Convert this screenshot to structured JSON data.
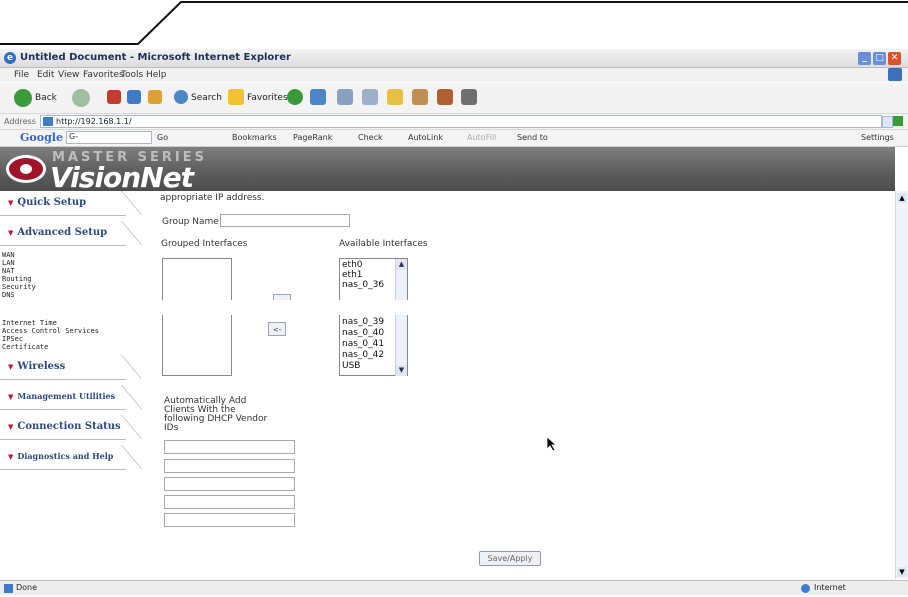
{
  "window": {
    "title": "Untitled Document - Microsoft Internet Explorer"
  },
  "menu": [
    "File",
    "Edit",
    "View",
    "Favorites",
    "Tools",
    "Help"
  ],
  "toolbar": {
    "back": "Back",
    "search": "Search",
    "favorites": "Favorites"
  },
  "address": {
    "label": "Address",
    "url": "http://192.168.1.1/",
    "go": "Go"
  },
  "google_bar": {
    "logo": "Google",
    "search_box": "G-",
    "go": "Go",
    "bookmarks": "Bookmarks",
    "pagerank": "PageRank",
    "check": "Check",
    "autolink": "AutoLink",
    "autofill": "AutoFill",
    "send_to": "Send to",
    "settings": "Settings"
  },
  "header": {
    "master_series": "MASTER SERIES",
    "brand": "VisionNet"
  },
  "sidebar": {
    "quick_setup": "Quick Setup",
    "advanced_setup": "Advanced Setup",
    "advanced_items_top": [
      "WAN",
      "LAN",
      "NAT",
      "Routing",
      "Security",
      "DNS"
    ],
    "advanced_items_bottom": [
      "Internet Time",
      "Access Control Services",
      "IPSec",
      "Certificate"
    ],
    "wireless": "Wireless",
    "management": "Management Utilities",
    "connection": "Connection Status",
    "diagnostics": "Diagnostics and Help"
  },
  "main": {
    "intro": "appropriate IP address.",
    "group_name_label": "Group Name:",
    "group_name_value": "",
    "grouped_label": "Grouped Interfaces",
    "available_label": "Available Interfaces",
    "available_top": [
      "eth0",
      "eth1",
      "nas_0_36"
    ],
    "available_bottom": [
      "nas_0_39",
      "nas_0_40",
      "nas_0_41",
      "nas_0_42",
      "USB"
    ],
    "move_left": "<-",
    "vendor_label": [
      "Automatically Add",
      "Clients With the",
      "following DHCP Vendor",
      "IDs"
    ],
    "vendor_ids": [
      "",
      "",
      "",
      "",
      ""
    ],
    "save_apply": "Save/Apply"
  },
  "status": {
    "left": "Done",
    "zone": "Internet"
  }
}
